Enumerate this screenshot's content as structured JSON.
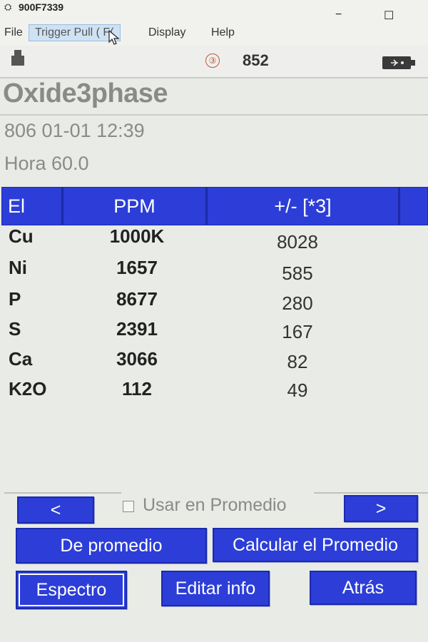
{
  "window": {
    "icon": "network-icon",
    "title": "900F7339",
    "minimize": "−",
    "maximize": "☐"
  },
  "menu": [
    {
      "label": "File"
    },
    {
      "label": "Trigger Pull ( F("
    },
    {
      "label": "Display"
    },
    {
      "label": "Help"
    }
  ],
  "toolbar": {
    "badge": "③",
    "count": "852"
  },
  "app_title": "Oxide3phase",
  "meta": {
    "sample": "806  01-01 12:39",
    "time": "Hora 60.0"
  },
  "table": {
    "headers": [
      "El",
      "PPM",
      "+/- [*3]"
    ],
    "rows": [
      {
        "el": "Cu",
        "ppm": "1000K",
        "err": "8028"
      },
      {
        "el": "Ni",
        "ppm": "1657",
        "err": "585"
      },
      {
        "el": "P",
        "ppm": "8677",
        "err": "280"
      },
      {
        "el": "S",
        "ppm": "2391",
        "err": "167"
      },
      {
        "el": "Ca",
        "ppm": "3066",
        "err": "82"
      },
      {
        "el": "K2O",
        "ppm": "112",
        "err": "49"
      }
    ]
  },
  "controls": {
    "prev": "<",
    "next": ">",
    "use_in_average": "Usar en Promedio",
    "use_in_average_checked": false,
    "average": "De promedio",
    "calculate_average": "Calcular el Promedio",
    "spectrum": "Espectro",
    "edit_info": "Editar info",
    "back": "Atrás"
  },
  "colors": {
    "accent": "#2c3ed7",
    "header_text": "#8a8b88",
    "background": "#e9ebe6"
  }
}
